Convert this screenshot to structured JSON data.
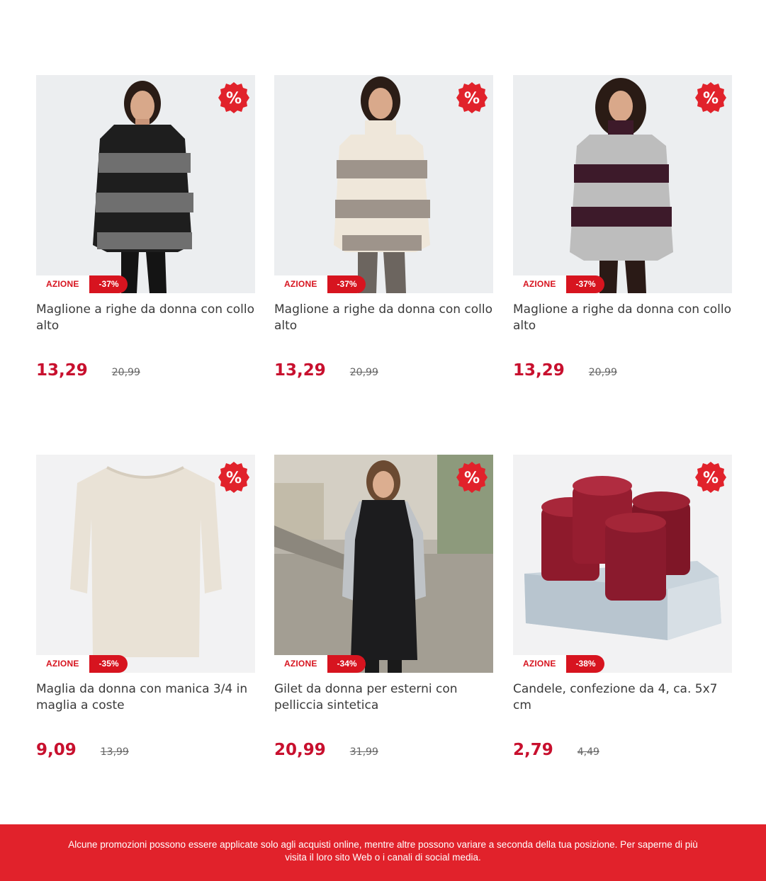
{
  "colors": {
    "accent": "#d7141f",
    "footer_bg": "#e1222b",
    "price": "#c8102e"
  },
  "products": [
    {
      "title": "Maglione a righe da donna con collo alto",
      "badge": "AZIONE",
      "discount": "-37%",
      "price": "13,29",
      "old_price": "20,99",
      "icon": "percent-icon"
    },
    {
      "title": "Maglione a righe da donna con collo alto",
      "badge": "AZIONE",
      "discount": "-37%",
      "price": "13,29",
      "old_price": "20,99",
      "icon": "percent-icon"
    },
    {
      "title": "Maglione a righe da donna con collo alto",
      "badge": "AZIONE",
      "discount": "-37%",
      "price": "13,29",
      "old_price": "20,99",
      "icon": "percent-icon"
    },
    {
      "title": "Maglia da donna con manica 3/4 in maglia a coste",
      "badge": "AZIONE",
      "discount": "-35%",
      "price": "9,09",
      "old_price": "13,99",
      "icon": "percent-icon"
    },
    {
      "title": "Gilet da donna per esterni con pelliccia sintetica",
      "badge": "AZIONE",
      "discount": "-34%",
      "price": "20,99",
      "old_price": "31,99",
      "icon": "percent-icon"
    },
    {
      "title": "Candele, confezione da 4, ca. 5x7 cm",
      "badge": "AZIONE",
      "discount": "-38%",
      "price": "2,79",
      "old_price": "4,49",
      "icon": "percent-icon"
    }
  ],
  "footer": {
    "line1": "Alcune promozioni possono essere applicate solo agli acquisti online, mentre altre possono variare a seconda della tua posizione. Per saperne di più",
    "line2": "visita il loro sito Web o i canali di social media."
  }
}
